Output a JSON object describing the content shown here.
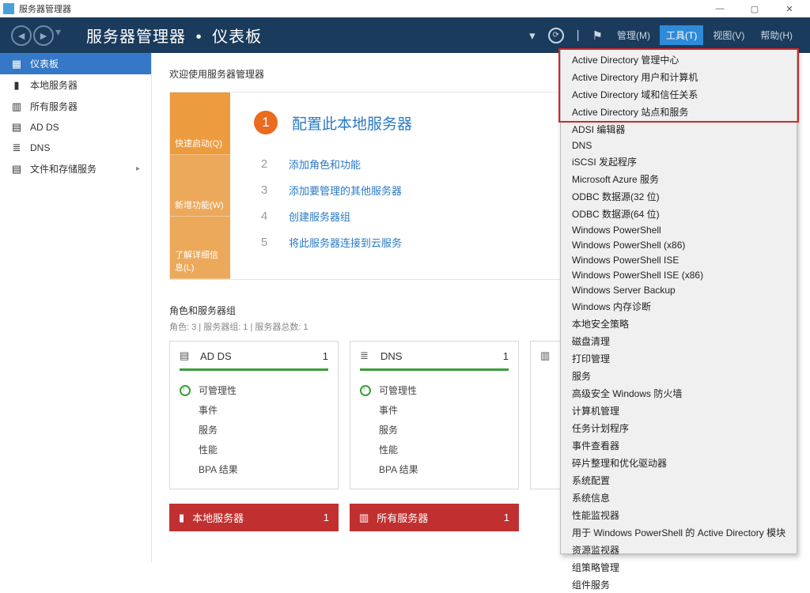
{
  "window": {
    "title": "服务器管理器",
    "controls": {
      "min": "—",
      "max": "▢",
      "close": "✕"
    }
  },
  "header": {
    "breadcrumb_app": "服务器管理器",
    "breadcrumb_page": "仪表板",
    "menus": {
      "manage": "管理(M)",
      "tools": "工具(T)",
      "view": "视图(V)",
      "help": "帮助(H)"
    }
  },
  "sidebar": {
    "items": [
      {
        "icon": "▦",
        "label": "仪表板"
      },
      {
        "icon": "▮",
        "label": "本地服务器"
      },
      {
        "icon": "▥",
        "label": "所有服务器"
      },
      {
        "icon": "▤",
        "label": "AD DS"
      },
      {
        "icon": "≣",
        "label": "DNS"
      },
      {
        "icon": "▤",
        "label": "文件和存储服务",
        "chevron": "▸"
      }
    ]
  },
  "welcome": {
    "title": "欢迎使用服务器管理器",
    "tabs": {
      "quick": "快速启动(Q)",
      "new": "新增功能(W)",
      "learn": "了解详细信息(L)"
    },
    "steps": [
      {
        "n": "1",
        "text": "配置此本地服务器",
        "primary": true
      },
      {
        "n": "2",
        "text": "添加角色和功能"
      },
      {
        "n": "3",
        "text": "添加要管理的其他服务器"
      },
      {
        "n": "4",
        "text": "创建服务器组"
      },
      {
        "n": "5",
        "text": "将此服务器连接到云服务"
      }
    ]
  },
  "roles": {
    "title": "角色和服务器组",
    "subtitle": "角色: 3 | 服务器组: 1 | 服务器总数: 1",
    "tiles": [
      {
        "icon": "▤",
        "title": "AD DS",
        "count": "1"
      },
      {
        "icon": "≣",
        "title": "DNS",
        "count": "1"
      },
      {
        "icon": "▥",
        "title": "",
        "count": ""
      }
    ],
    "rows": {
      "manage": "可管理性",
      "events": "事件",
      "services": "服务",
      "perf": "性能",
      "bpa": "BPA 结果"
    },
    "red": [
      {
        "icon": "▮",
        "title": "本地服务器",
        "count": "1"
      },
      {
        "icon": "▥",
        "title": "所有服务器",
        "count": "1"
      }
    ]
  },
  "tools_menu": {
    "highlighted": [
      "Active Directory 管理中心",
      "Active Directory 用户和计算机",
      "Active Directory 域和信任关系",
      "Active Directory 站点和服务"
    ],
    "items": [
      "ADSI 编辑器",
      "DNS",
      "iSCSI 发起程序",
      "Microsoft Azure 服务",
      "ODBC 数据源(32 位)",
      "ODBC 数据源(64 位)",
      "Windows PowerShell",
      "Windows PowerShell (x86)",
      "Windows PowerShell ISE",
      "Windows PowerShell ISE (x86)",
      "Windows Server Backup",
      "Windows 内存诊断",
      "本地安全策略",
      "磁盘清理",
      "打印管理",
      "服务",
      "高级安全 Windows 防火墙",
      "计算机管理",
      "任务计划程序",
      "事件查看器",
      "碎片整理和优化驱动器",
      "系统配置",
      "系统信息",
      "性能监视器",
      "用于 Windows PowerShell 的 Active Directory 模块",
      "资源监视器",
      "组策略管理",
      "组件服务"
    ]
  }
}
